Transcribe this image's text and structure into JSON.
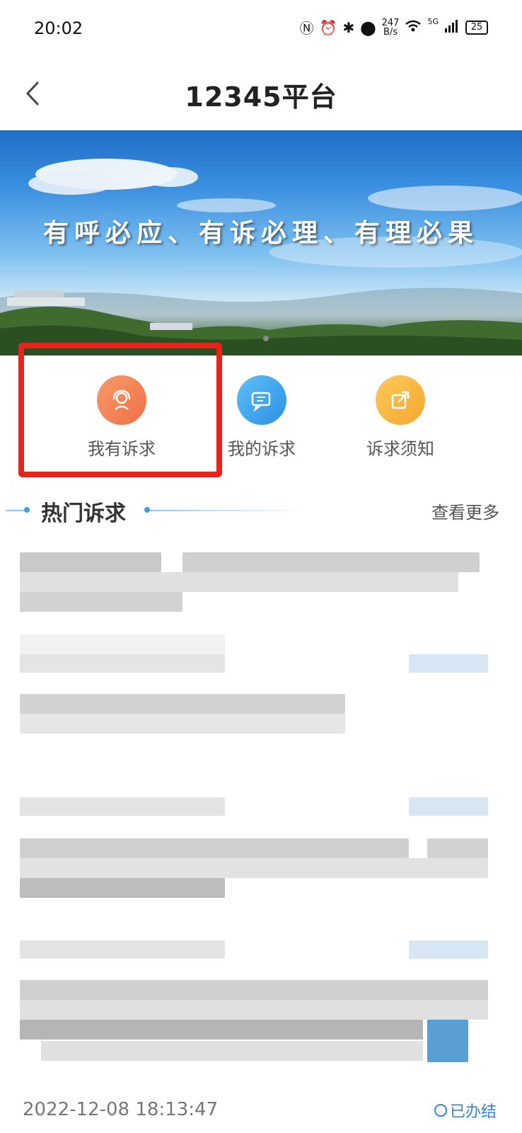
{
  "status_bar": {
    "time": "20:02",
    "net_speed_top": "247",
    "net_speed_bottom": "B/s",
    "signal": "5G",
    "battery": "25"
  },
  "header": {
    "title": "12345平台"
  },
  "banner": {
    "slogan": "有呼必应、有诉必理、有理必果"
  },
  "quick_actions": [
    {
      "label": "我有诉求",
      "icon": "headset-person-icon",
      "color": "#f07a4e"
    },
    {
      "label": "我的诉求",
      "icon": "chat-bubble-icon",
      "color": "#3aa6ee"
    },
    {
      "label": "诉求须知",
      "icon": "external-link-icon",
      "color": "#f6b13a"
    }
  ],
  "hot_section": {
    "title": "热门诉求",
    "more": "查看更多"
  },
  "list_footer": {
    "date": "2022-12-08 18:13:47",
    "status": "已办结"
  },
  "colors": {
    "highlight_border": "#e8231b",
    "accent": "#2f86d6"
  }
}
